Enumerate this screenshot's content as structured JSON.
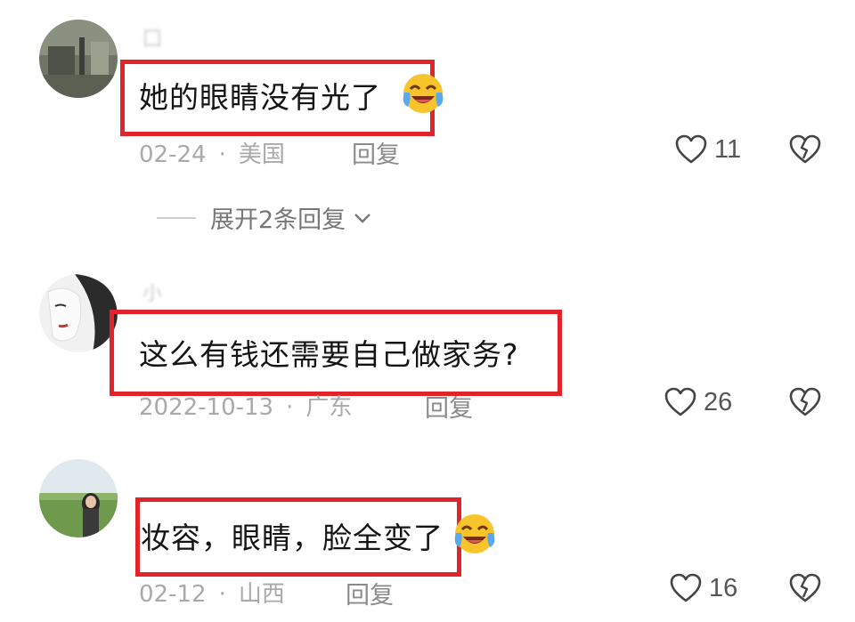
{
  "comments": [
    {
      "username": "囗",
      "text": "她的眼睛没有光了",
      "date": "02-24",
      "location": "美国",
      "reply_label": "回复",
      "likes": "11",
      "emoji": "laughing-tears-emoji",
      "expand_label": "展开2条回复"
    },
    {
      "username": "小",
      "text": "这么有钱还需要自己做家务?",
      "date": "2022-10-13",
      "location": "广东",
      "reply_label": "回复",
      "likes": "26"
    },
    {
      "username": "",
      "text": "妆容，眼睛，脸全变了",
      "date": "02-12",
      "location": "山西",
      "reply_label": "回复",
      "likes": "16",
      "emoji": "laughing-tears-emoji"
    }
  ],
  "colors": {
    "highlight_border": "#e0242a",
    "text": "#141414",
    "meta": "#a9a9a9"
  },
  "icons": {
    "like": "heart-outline-icon",
    "dislike": "broken-heart-icon",
    "expand": "chevron-down-icon"
  }
}
